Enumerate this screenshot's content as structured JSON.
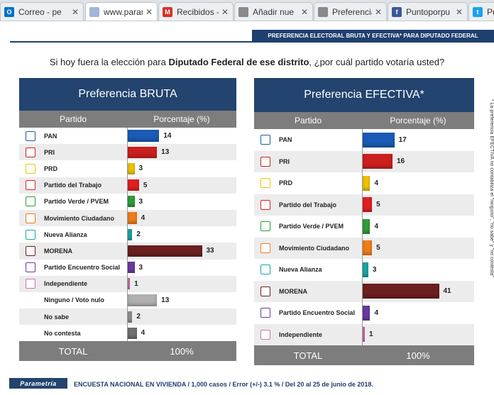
{
  "browser": {
    "tabs": [
      {
        "label": "Correo - pe",
        "icon": "outlook-icon",
        "color": "#0072c6"
      },
      {
        "label": "www.paramet",
        "icon": "loading-icon",
        "color": "#9fb6d8",
        "active": true
      },
      {
        "label": "Recibidos -",
        "icon": "gmail-icon",
        "color": "#d93025"
      },
      {
        "label": "Añadir nue",
        "icon": "page-icon",
        "color": "#8a8a8a"
      },
      {
        "label": "Preferencia",
        "icon": "page-icon",
        "color": "#8a8a8a"
      },
      {
        "label": "Puntoporpu",
        "icon": "facebook-icon",
        "color": "#3b5998"
      },
      {
        "label": "Pun",
        "icon": "twitter-icon",
        "color": "#1da1f2"
      }
    ]
  },
  "header": {
    "banner": "PREFERENCIA ELECTORAL BRUTA Y EFECTIVA* PARA DIPUTADO FEDERAL",
    "question_pre": "Si hoy fuera la elección para ",
    "question_bold": "Diputado Federal de ese distrito",
    "question_post": ", ¿por cuál partido votaría usted?"
  },
  "bruta": {
    "title": "Preferencia BRUTA",
    "col_party": "Partido",
    "col_pct": "Porcentaje (%)",
    "total_label": "TOTAL",
    "total_value": "100%",
    "rows": [
      {
        "party": "PAN",
        "value": 14,
        "color": "#1a5bb5",
        "logo": "pan-logo"
      },
      {
        "party": "PRI",
        "value": 13,
        "color": "#cc1f1f",
        "logo": "pri-logo"
      },
      {
        "party": "PRD",
        "value": 3,
        "color": "#f2c200",
        "logo": "prd-logo"
      },
      {
        "party": "Partido del Trabajo",
        "value": 5,
        "color": "#e02020",
        "logo": "pt-logo"
      },
      {
        "party": "Partido Verde / PVEM",
        "value": 3,
        "color": "#2e9e3a",
        "logo": "pvem-logo"
      },
      {
        "party": "Movimiento Ciudadano",
        "value": 4,
        "color": "#f07d1a",
        "logo": "mc-logo"
      },
      {
        "party": "Nueva Alianza",
        "value": 2,
        "color": "#1aa6a6",
        "logo": "panal-logo"
      },
      {
        "party": "MORENA",
        "value": 33,
        "color": "#6b1f1f",
        "logo": "morena-logo"
      },
      {
        "party": "Partido Encuentro Social",
        "value": 3,
        "color": "#6a3aa0",
        "logo": "pes-logo"
      },
      {
        "party": "Independiente",
        "value": 1,
        "color": "#d070b0",
        "logo": "independiente-logo"
      },
      {
        "party": "Ninguno / Voto nulo",
        "value": 13,
        "color": "#b0b0b0",
        "logo": ""
      },
      {
        "party": "No sabe",
        "value": 2,
        "color": "#909090",
        "logo": ""
      },
      {
        "party": "No contesta",
        "value": 4,
        "color": "#707070",
        "logo": ""
      }
    ]
  },
  "efectiva": {
    "title": "Preferencia EFECTIVA*",
    "col_party": "Partido",
    "col_pct": "Porcentaje (%)",
    "total_label": "TOTAL",
    "total_value": "100%",
    "rows": [
      {
        "party": "PAN",
        "value": 17,
        "color": "#1a5bb5",
        "logo": "pan-logo"
      },
      {
        "party": "PRI",
        "value": 16,
        "color": "#cc1f1f",
        "logo": "pri-logo"
      },
      {
        "party": "PRD",
        "value": 4,
        "color": "#f2c200",
        "logo": "prd-logo"
      },
      {
        "party": "Partido del Trabajo",
        "value": 5,
        "color": "#e02020",
        "logo": "pt-logo"
      },
      {
        "party": "Partido Verde / PVEM",
        "value": 4,
        "color": "#2e9e3a",
        "logo": "pvem-logo"
      },
      {
        "party": "Movimiento Ciudadano",
        "value": 5,
        "color": "#f07d1a",
        "logo": "mc-logo"
      },
      {
        "party": "Nueva Alianza",
        "value": 3,
        "color": "#1aa6a6",
        "logo": "panal-logo"
      },
      {
        "party": "MORENA",
        "value": 41,
        "color": "#6b1f1f",
        "logo": "morena-logo"
      },
      {
        "party": "Partido Encuentro Social",
        "value": 4,
        "color": "#6a3aa0",
        "logo": "pes-logo"
      },
      {
        "party": "Independiente",
        "value": 1,
        "color": "#d070b0",
        "logo": "independiente-logo"
      }
    ]
  },
  "side_note": "* La preferencia EFECTIVA no contabiliza el \"ninguno\", \"no sabe\" y \"no contesta\"",
  "footer": {
    "logo_text": "Parametría",
    "text": "ENCUESTA NACIONAL EN VIVIENDA / 1,000 casos / Error (+/-) 3.1 % / Del 20 al 25 de junio de 2018."
  }
}
